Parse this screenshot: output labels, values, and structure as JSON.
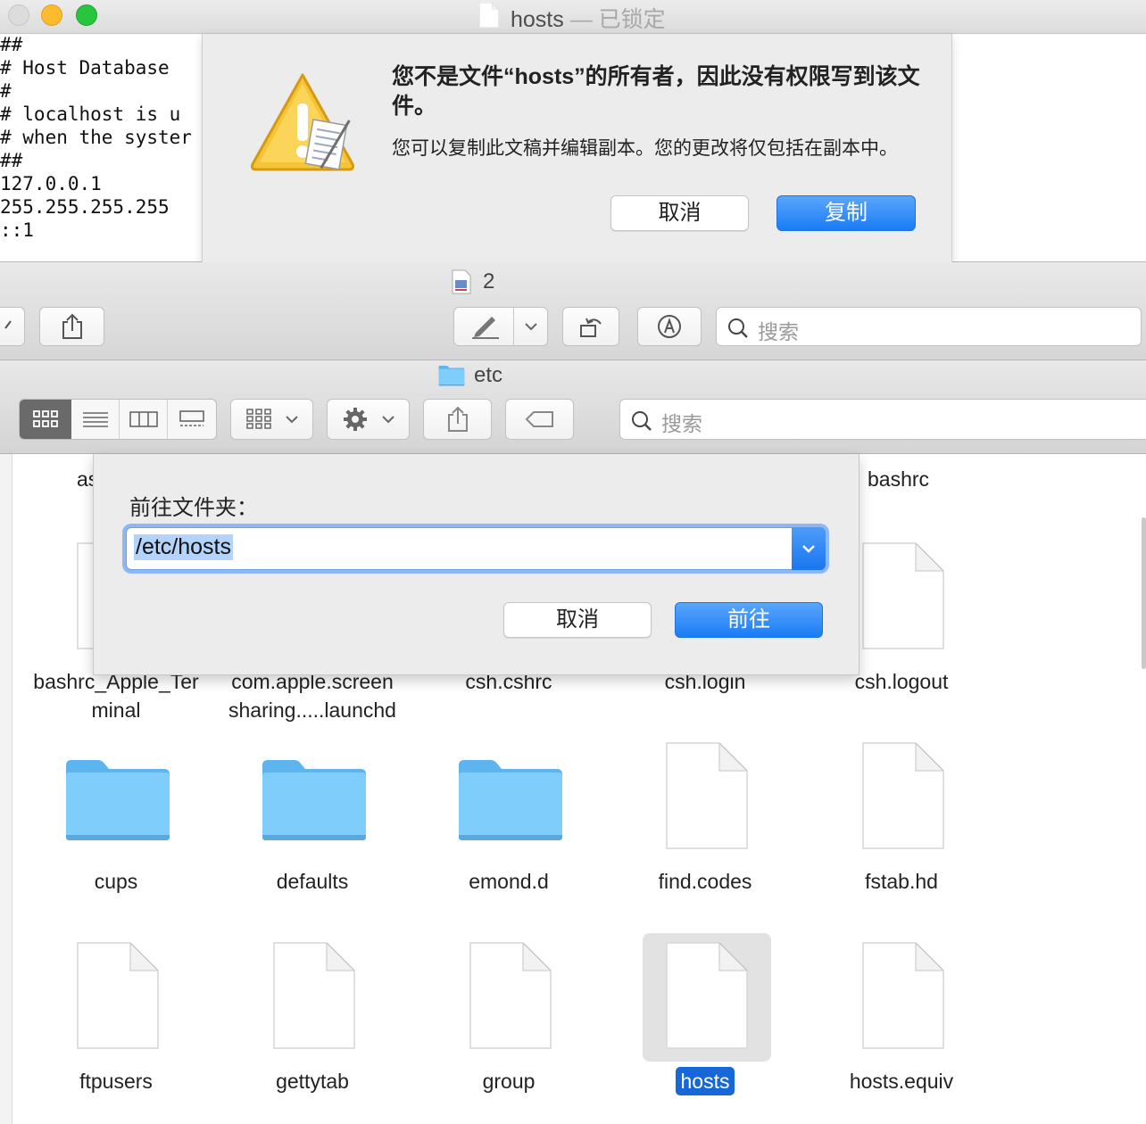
{
  "textedit": {
    "title": "hosts",
    "title_separator": "—",
    "title_locked": "已锁定",
    "lines": [
      "##",
      "# Host Database",
      "#",
      "# localhost is u",
      "# when the syster",
      "##",
      "127.0.0.1",
      "255.255.255.255",
      "::1"
    ]
  },
  "alert": {
    "title": "您不是文件“hosts”的所有者，因此没有权限写到该文件。",
    "message": "您可以复制此文稿并编辑副本。您的更改将仅包括在副本中。",
    "cancel_label": "取消",
    "duplicate_label": "复制"
  },
  "preview": {
    "title": "2",
    "search_placeholder": "搜索"
  },
  "finder": {
    "title": "etc",
    "search_placeholder": "搜索",
    "partial_top_left": "as",
    "partial_top_right": "bashrc",
    "items": [
      {
        "name": "bashrc_Apple_Ter",
        "name2": "minal",
        "kind": "file"
      },
      {
        "name": "com.apple.screen",
        "name2": "sharing.....launchd",
        "kind": "file"
      },
      {
        "name": "csh.cshrc",
        "kind": "file"
      },
      {
        "name": "csh.login",
        "kind": "file"
      },
      {
        "name": "csh.logout",
        "kind": "file"
      },
      {
        "name": "cups",
        "kind": "folder"
      },
      {
        "name": "defaults",
        "kind": "folder"
      },
      {
        "name": "emond.d",
        "kind": "folder"
      },
      {
        "name": "find.codes",
        "kind": "file"
      },
      {
        "name": "fstab.hd",
        "kind": "file"
      },
      {
        "name": "ftpusers",
        "kind": "file"
      },
      {
        "name": "gettytab",
        "kind": "file"
      },
      {
        "name": "group",
        "kind": "file"
      },
      {
        "name": "hosts",
        "kind": "file",
        "selected": true
      },
      {
        "name": "hosts.equiv",
        "kind": "file"
      }
    ]
  },
  "goto_sheet": {
    "label": "前往文件夹：",
    "value": "/etc/hosts",
    "cancel_label": "取消",
    "go_label": "前往"
  },
  "colors": {
    "accent": "#1a7cf5",
    "selection": "#1668d8",
    "folder": "#6ec3f7"
  }
}
